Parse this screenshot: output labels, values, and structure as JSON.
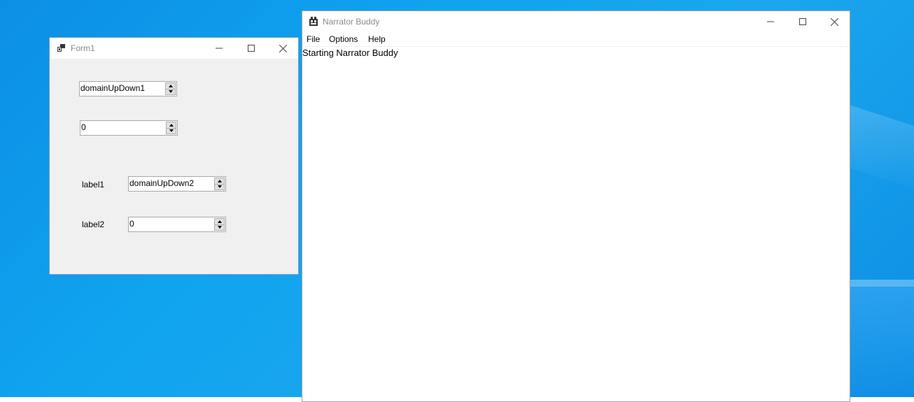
{
  "form1": {
    "title": "Form1",
    "controls": {
      "domain_updown_1": {
        "value": "domainUpDown1"
      },
      "numeric_updown_1": {
        "value": "0"
      },
      "label1": "label1",
      "domain_updown_2": {
        "value": "domainUpDown2"
      },
      "label2": "label2",
      "numeric_updown_2": {
        "value": "0"
      }
    }
  },
  "narrator_buddy": {
    "title": "Narrator Buddy",
    "menu": [
      "File",
      "Options",
      "Help"
    ],
    "log": "Starting Narrator Buddy"
  },
  "icons": {
    "minimize": "minimize-icon",
    "maximize": "maximize-icon",
    "close": "close-icon",
    "app": "app-icon"
  }
}
